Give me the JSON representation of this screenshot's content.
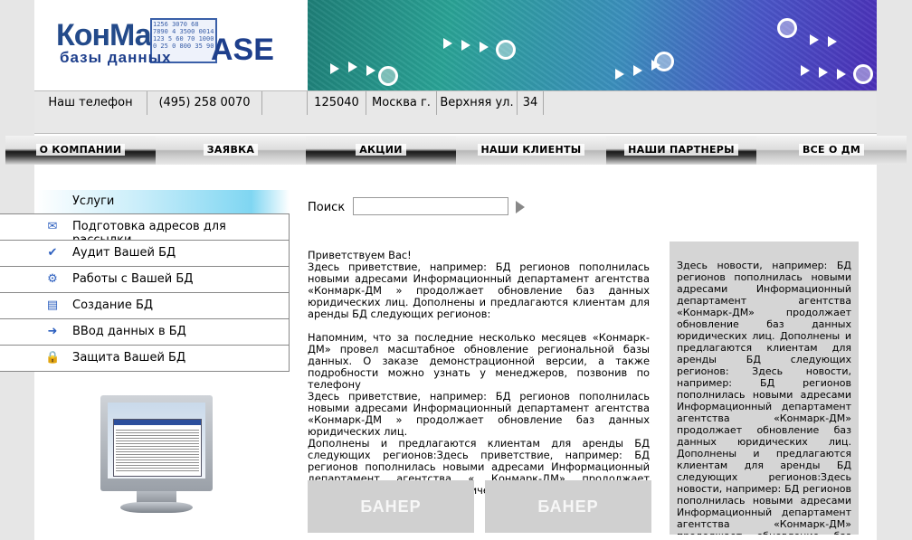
{
  "logo": {
    "main": "КонМарк",
    "base": "ASE",
    "sub": "базы данных",
    "grid": "1256 3070 68 7890 4 3500 0014 123 5 60 70 1000 0 25 0 800 35 90"
  },
  "contacts": {
    "phone_label": "Наш телефон",
    "phone": "(495) 258  0070",
    "zip": "125040",
    "city": "Москва г.",
    "street": "Верхняя ул.",
    "house": "34"
  },
  "nav": {
    "items": [
      "О КОМПАНИИ",
      "ЗАЯВКА",
      "АКЦИИ",
      "НАШИ КЛИЕНТЫ",
      "НАШИ ПАРТНЕРЫ",
      "ВСЕ  О ДМ"
    ]
  },
  "sidebar": {
    "title": "Услуги",
    "items": [
      {
        "label": "Подготовка адресов для рассылки",
        "icon": "envelope-icon"
      },
      {
        "label": "Аудит Вашей БД",
        "icon": "checkmark-icon"
      },
      {
        "label": "Работы с Вашей БД",
        "icon": "gears-icon"
      },
      {
        "label": "Создание БД",
        "icon": "database-blocks-icon"
      },
      {
        "label": "ВВод данных в БД",
        "icon": "arrow-right-icon"
      },
      {
        "label": "Защита Вашей БД",
        "icon": "lock-icon"
      }
    ]
  },
  "search": {
    "label": "Поиск",
    "value": ""
  },
  "main": {
    "greeting": "Приветствуем Вас!",
    "p1": "Здесь приветствие, например: БД регионов пополнилась новыми адресами Информационный департамент агентства «Конмарк-ДМ » продолжает обновление баз данных юридических лиц. Дополнены и предлагаются клиентам для аренды БД следующих регионов:",
    "p2": "Напомним, что за последние несколько месяцев «Конмарк-ДМ» провел масштабное обновление региональной базы данных. О заказе демонстрационной версии, а также подробности можно узнать у менеджеров, позвонив по телефону",
    "p3": "Здесь приветствие, например: БД регионов пополнилась новыми адресами Информационный департамент агентства «Конмарк-ДМ » продолжает обновление баз данных юридических лиц.",
    "p4": "Дополнены и предлагаются клиентам для аренды БД следующих регионов:Здесь приветствие, например: БД регионов пополнилась новыми адресами Информационный департамент агентства « Конмарк-ДМ» продолжает обновление баз данных юридических"
  },
  "banners": [
    "БАНЕР",
    "БАНЕР"
  ],
  "news": {
    "text": "Здесь новости, например: БД регионов пополнилась новыми адресами Информационный департамент агентства «Конмарк-ДМ» продолжает обновление баз данных юридических лиц. Дополнены и предлагаются клиентам для аренды БД следующих регионов: Здесь новости, например: БД регионов пополнилась новыми адресами Информационный департамент агентства «Конмарк-ДМ» продолжает обновление баз данных юридических лиц. Дополнены и предлагаются клиентам для аренды БД следующих регионов:Здесь новости, например: БД регионов пополнилась новыми адресами Информационный департамент агентства «Конмарк-ДМ» продолжает обновление баз данных"
  },
  "colors": {
    "brand_blue": "#1e3f8c",
    "service_header": "#7fd6f2",
    "banner_placeholder": "#d0d0d0",
    "news_bg": "#d5d5d5"
  }
}
